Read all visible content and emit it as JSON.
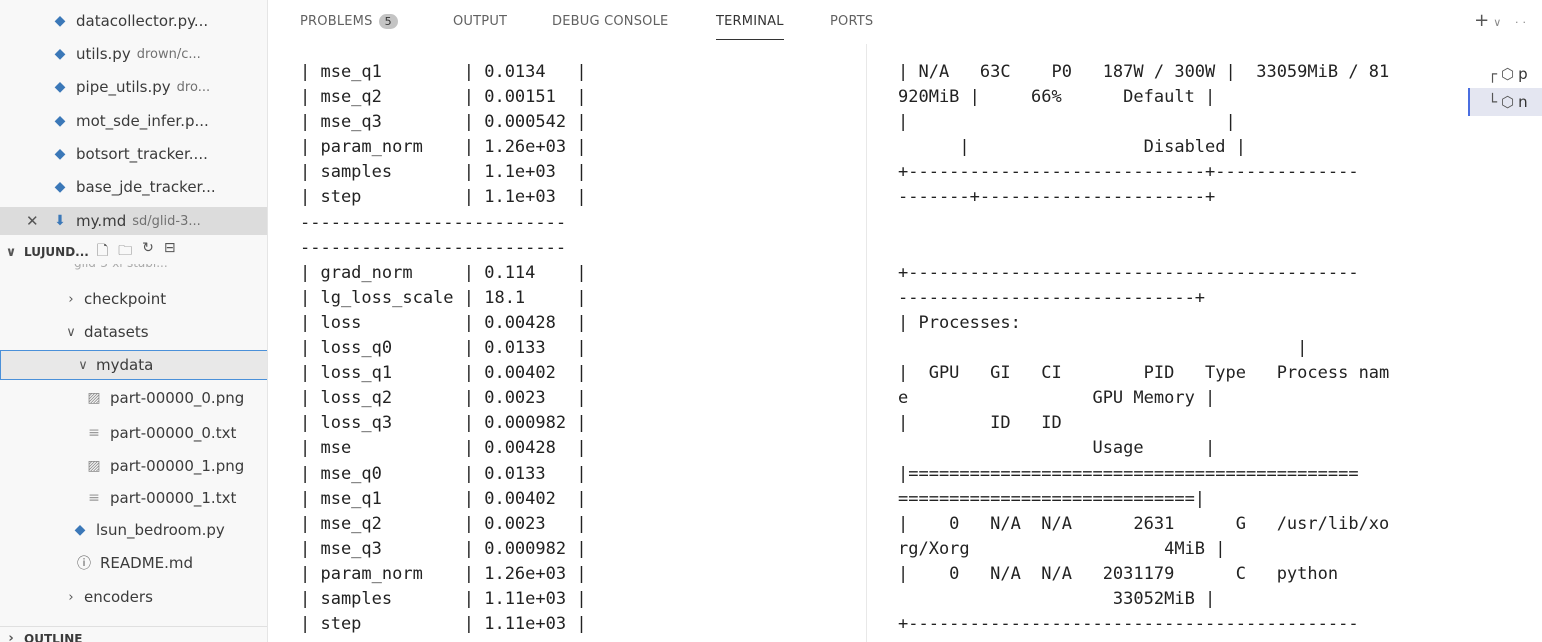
{
  "explorer": {
    "items": [
      {
        "icon": "python-file-icon",
        "label": "datacollector.py...",
        "desc": ""
      },
      {
        "icon": "python-file-icon",
        "label": "utils.py",
        "desc": "drown/c..."
      },
      {
        "icon": "python-file-icon",
        "label": "pipe_utils.py",
        "desc": "dro..."
      },
      {
        "icon": "python-file-icon",
        "label": "mot_sde_infer.p...",
        "desc": ""
      },
      {
        "icon": "python-file-icon",
        "label": "botsort_tracker....",
        "desc": ""
      },
      {
        "icon": "python-file-icon",
        "label": "base_jde_tracker...",
        "desc": ""
      },
      {
        "icon": "markdown-file-icon",
        "label": "my.md",
        "desc": "sd/glid-3..."
      }
    ],
    "section_title": "LUJUND...",
    "ghost_folder": "glid-3-xl-stabl...",
    "tree": [
      {
        "type": "folder-collapsed",
        "label": "checkpoint"
      },
      {
        "type": "folder-expanded",
        "label": "datasets"
      },
      {
        "type": "folder-expanded",
        "label": "mydata"
      },
      {
        "type": "image",
        "label": "part-00000_0.png"
      },
      {
        "type": "text",
        "label": "part-00000_0.txt"
      },
      {
        "type": "image",
        "label": "part-00000_1.png"
      },
      {
        "type": "text",
        "label": "part-00000_1.txt"
      },
      {
        "type": "python",
        "label": "lsun_bedroom.py"
      },
      {
        "type": "info",
        "label": "README.md"
      },
      {
        "type": "folder-collapsed",
        "label": "encoders"
      }
    ],
    "outline_title": "OUTLINE"
  },
  "panel": {
    "tabs": [
      {
        "label": "PROBLEMS",
        "badge": "5"
      },
      {
        "label": "OUTPUT"
      },
      {
        "label": "DEBUG CONSOLE"
      },
      {
        "label": "TERMINAL",
        "active": true
      },
      {
        "label": "PORTS"
      }
    ],
    "actions": {
      "add": "+",
      "dropdown": "∨",
      "more": "··"
    }
  },
  "terminal_left": [
    "| mse_q1        | 0.0134   |",
    "| mse_q2        | 0.00151  |",
    "| mse_q3        | 0.000542 |",
    "| param_norm    | 1.26e+03 |",
    "| samples       | 1.1e+03  |",
    "| step          | 1.1e+03  |",
    "--------------------------",
    "--------------------------",
    "| grad_norm     | 0.114    |",
    "| lg_loss_scale | 18.1     |",
    "| loss          | 0.00428  |",
    "| loss_q0       | 0.0133   |",
    "| loss_q1       | 0.00402  |",
    "| loss_q2       | 0.0023   |",
    "| loss_q3       | 0.000982 |",
    "| mse           | 0.00428  |",
    "| mse_q0        | 0.0133   |",
    "| mse_q1        | 0.00402  |",
    "| mse_q2        | 0.0023   |",
    "| mse_q3        | 0.000982 |",
    "| param_norm    | 1.26e+03 |",
    "| samples       | 1.11e+03 |",
    "| step          | 1.11e+03 |"
  ],
  "terminal_right": [
    "| N/A   63C    P0   187W / 300W |  33059MiB / 81",
    "920MiB |     66%      Default |",
    "|                               |",
    "      |                 Disabled |",
    "+-----------------------------+--------------",
    "-------+----------------------+",
    "",
    "",
    "+--------------------------------------------",
    "-----------------------------+",
    "| Processes:",
    "                                       |",
    "|  GPU   GI   CI        PID   Type   Process nam",
    "e                  GPU Memory |",
    "|        ID   ID",
    "                   Usage      |",
    "|============================================",
    "=============================|",
    "|    0   N/A  N/A      2631      G   /usr/lib/xo",
    "rg/Xorg                   4MiB |",
    "|    0   N/A  N/A   2031179      C   python",
    "                     33052MiB |",
    "+--------------------------------------------"
  ],
  "terminal_list": [
    {
      "icon": "tree-top-connector",
      "label": "p"
    },
    {
      "icon": "tree-bottom-connector",
      "label": "n",
      "active": true
    }
  ]
}
